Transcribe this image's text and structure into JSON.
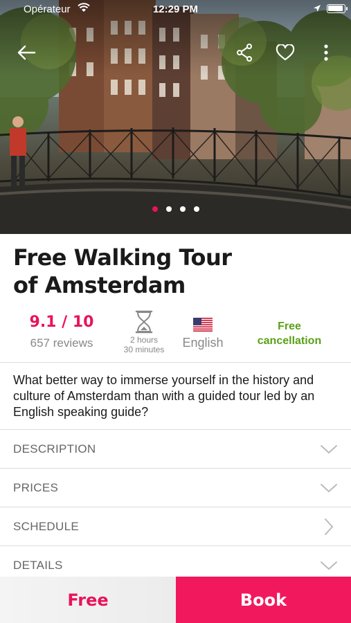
{
  "status_bar": {
    "carrier": "Opérateur",
    "time": "12:29 PM"
  },
  "hero": {
    "image_subject": "Amsterdam canal bridge with canal houses",
    "carousel_count": 4,
    "carousel_active_index": 0,
    "icons": {
      "back": "arrow-left-icon",
      "share": "share-icon",
      "favorite": "heart-icon",
      "more": "more-vertical-icon"
    }
  },
  "tour": {
    "title_line1": "Free Walking Tour",
    "title_line2": "of Amsterdam"
  },
  "stats": {
    "rating": "9.1 / 10",
    "reviews": "657 reviews",
    "duration_line1": "2 hours",
    "duration_line2": "30 minutes",
    "language": "English",
    "cancellation_line1": "Free",
    "cancellation_line2": "cancellation"
  },
  "description_text": "What better way to immerse yourself in the history and culture of Amsterdam than with a guided tour led by an English speaking guide?",
  "sections": [
    {
      "label": "DESCRIPTION",
      "icon": "chevron-down-icon"
    },
    {
      "label": "PRICES",
      "icon": "chevron-down-icon"
    },
    {
      "label": "SCHEDULE",
      "icon": "chevron-right-icon"
    },
    {
      "label": "DETAILS",
      "icon": "chevron-down-icon"
    }
  ],
  "bottom_bar": {
    "price": "Free",
    "book": "Book"
  },
  "colors": {
    "accent": "#e8135b",
    "book_button": "#f2185e",
    "cancellation_green": "#5aa016",
    "muted_text": "#888888"
  }
}
